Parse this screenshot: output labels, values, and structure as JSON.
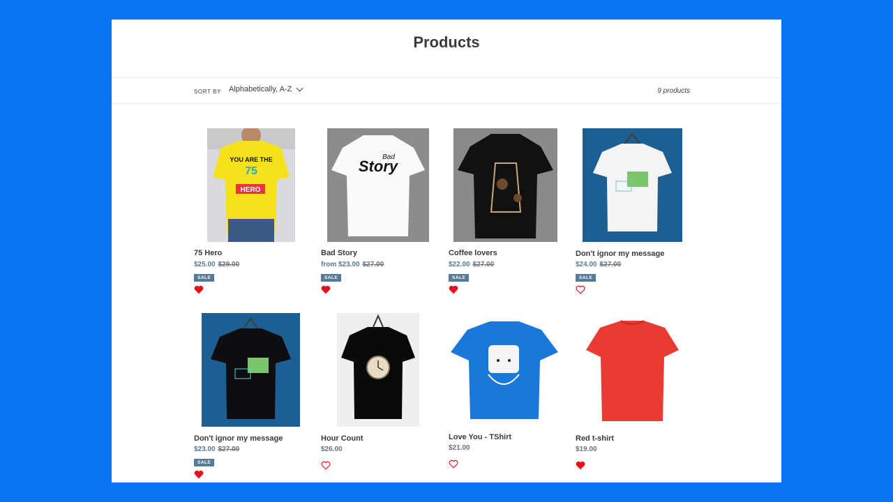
{
  "title": "Products",
  "filter": {
    "sort_label": "Sort by",
    "sort_value": "Alphabetically, A-Z",
    "product_count": "9 products"
  },
  "products": [
    {
      "name": "75 Hero",
      "price": "$25.00",
      "compare_price": "$29.00",
      "sale_label": "SALE",
      "favorited": true
    },
    {
      "name": "Bad Story",
      "price": "from $23.00",
      "compare_price": "$27.00",
      "sale_label": "SALE",
      "favorited": true
    },
    {
      "name": "Coffee lovers",
      "price": "$22.00",
      "compare_price": "$27.00",
      "sale_label": "SALE",
      "favorited": true
    },
    {
      "name": "Don't ignor my message",
      "price": "$24.00",
      "compare_price": "$27.00",
      "sale_label": "SALE",
      "favorited": false
    },
    {
      "name": "Don't ignor my message",
      "price": "$23.00",
      "compare_price": "$27.00",
      "sale_label": "SALE",
      "favorited": true
    },
    {
      "name": "Hour Count",
      "price": "$26.00",
      "compare_price": "",
      "sale_label": "",
      "favorited": false
    },
    {
      "name": "Love You - TShirt",
      "price": "$21.00",
      "compare_price": "",
      "sale_label": "",
      "favorited": false
    },
    {
      "name": "Red t-shirt",
      "price": "$19.00",
      "compare_price": "",
      "sale_label": "",
      "favorited": true
    }
  ],
  "colors": {
    "background": "#0a73f0",
    "sale_badge": "#557b97",
    "heart": "#e8101a"
  },
  "icons": {
    "sort_dropdown": "chevron-down-icon",
    "favorite": "heart-icon"
  }
}
